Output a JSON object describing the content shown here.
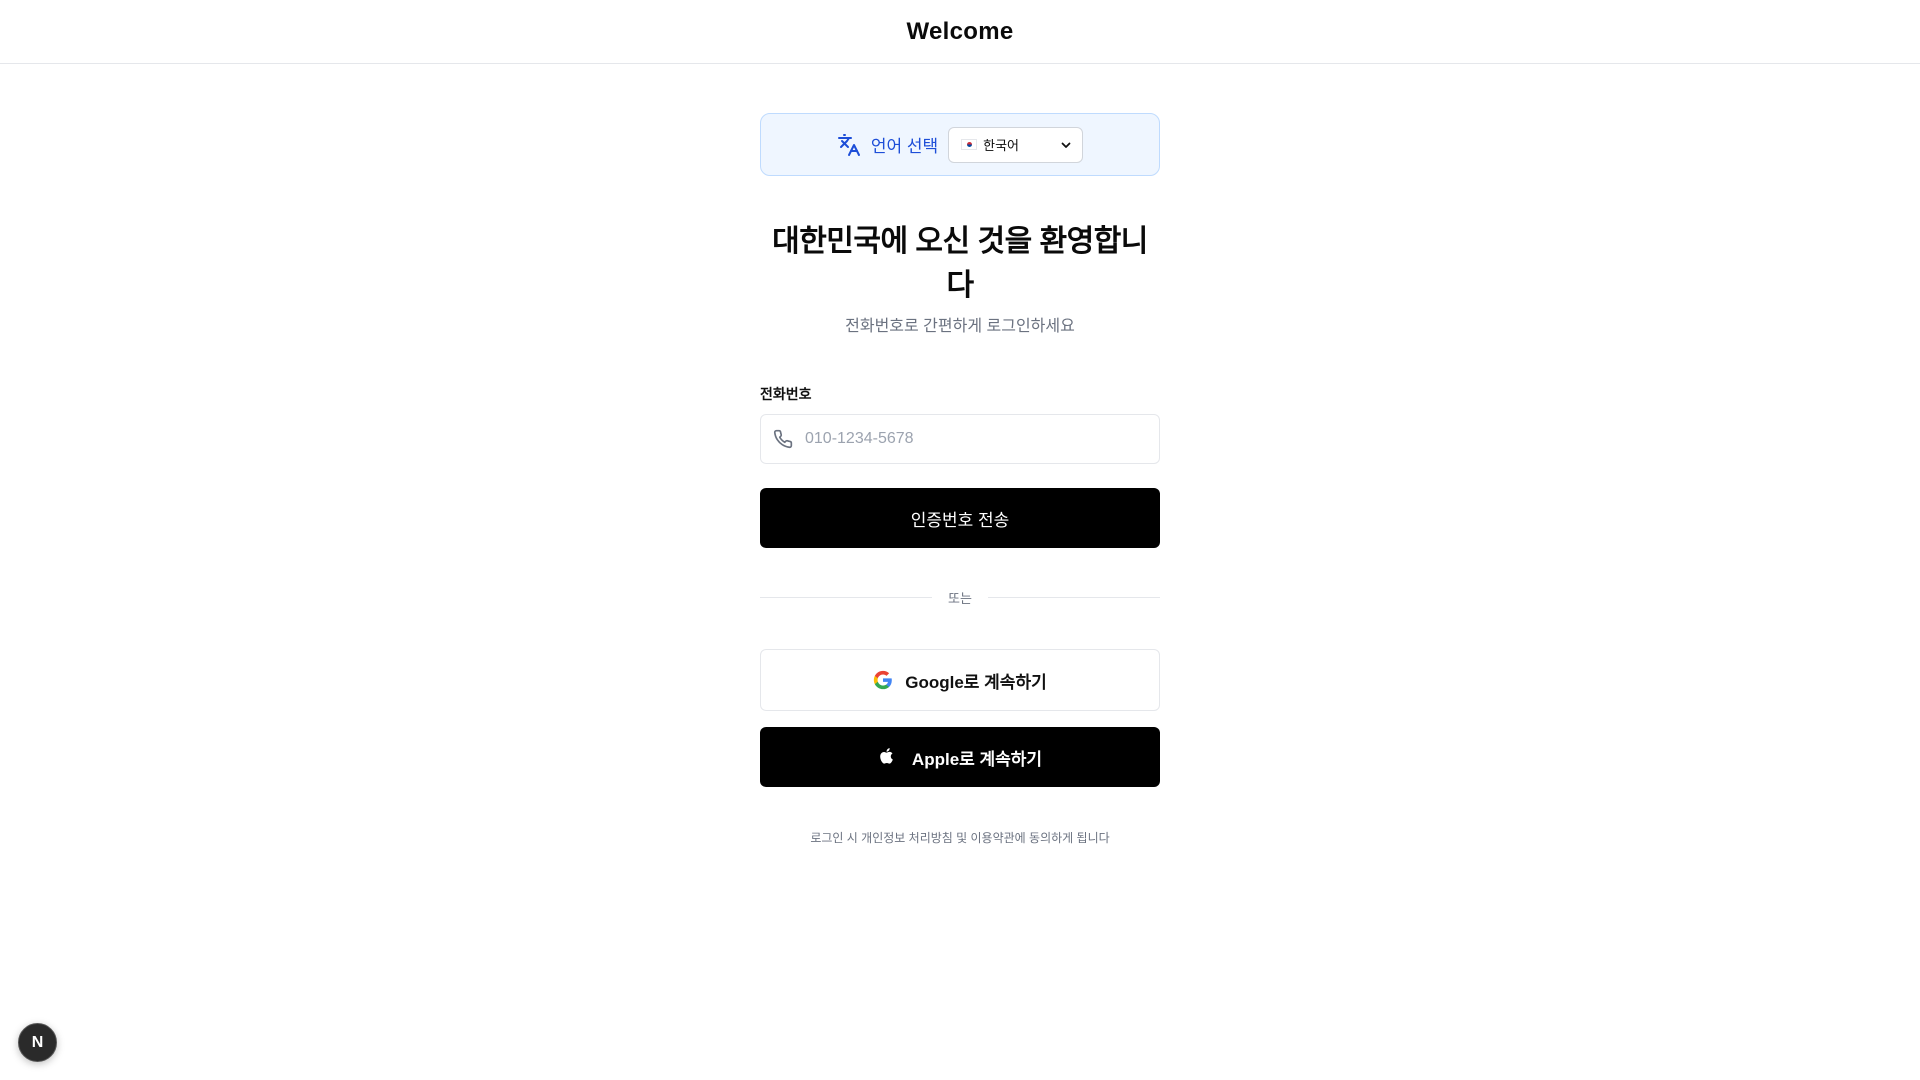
{
  "header": {
    "title": "Welcome"
  },
  "language": {
    "label": "언어 선택",
    "selected": "한국어",
    "icon": "translate-icon"
  },
  "hero": {
    "title": "대한민국에 오신 것을 환영합니다",
    "subtitle": "전화번호로 간편하게 로그인하세요"
  },
  "phone": {
    "label": "전화번호",
    "placeholder": "010-1234-5678",
    "value": ""
  },
  "actions": {
    "send_code": "인증번호 전송",
    "divider": "또는",
    "google": "Google로 계속하기",
    "apple": "Apple로 계속하기"
  },
  "terms": "로그인 시 개인정보 처리방침 및 이용약관에 동의하게 됩니다",
  "dev_badge": "N",
  "colors": {
    "accent_blue": "#1d4ed8",
    "lang_bg": "#eff6ff",
    "primary_button": "#000000"
  }
}
